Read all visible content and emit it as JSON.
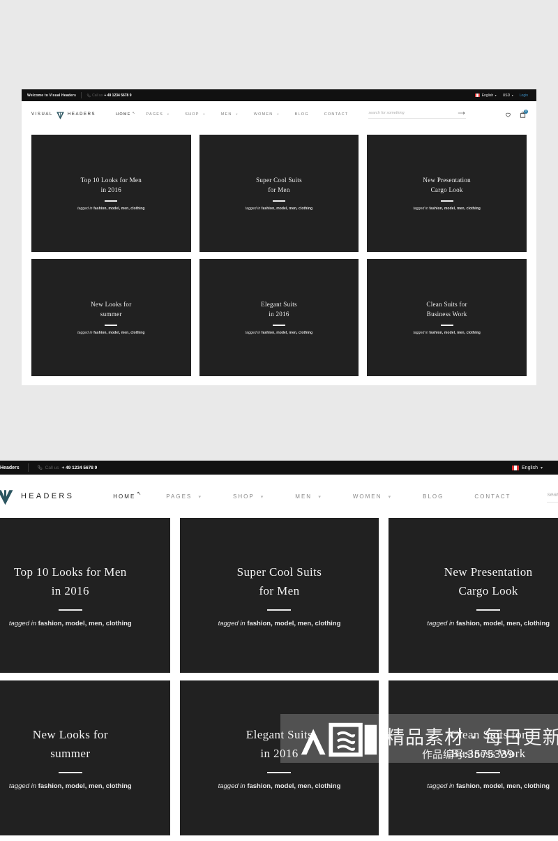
{
  "site": {
    "background_color": "#e9e9e9",
    "accent_color": "#2f7fa8",
    "card_color": "#212121",
    "topbar_color": "#111111"
  },
  "topbar": {
    "welcome": "Welcome to Visual Headers",
    "call_us_label": "Call us",
    "phone": "+ 49 1234 5678 9",
    "language": "English",
    "currency": "USD",
    "login": "Login",
    "caret": "▾",
    "phone_icon": "phone-icon",
    "flag_icon": "flag-icon"
  },
  "brand": {
    "word_left": "VISUAL",
    "word_right": "HEADERS",
    "mark": "v-shield-logo"
  },
  "nav": {
    "items": [
      {
        "label": "HOME",
        "caret": "",
        "superscript": "↖",
        "active": true
      },
      {
        "label": "PAGES",
        "caret": "▾",
        "superscript": "",
        "active": false
      },
      {
        "label": "SHOP",
        "caret": "▾",
        "superscript": "",
        "active": false
      },
      {
        "label": "MEN",
        "caret": "▾",
        "superscript": "",
        "active": false
      },
      {
        "label": "WOMEN",
        "caret": "▾",
        "superscript": "",
        "active": false
      },
      {
        "label": "BLOG",
        "caret": "",
        "superscript": "",
        "active": false
      },
      {
        "label": "CONTACT",
        "caret": "",
        "superscript": "",
        "active": false
      }
    ]
  },
  "search": {
    "placeholder": "search for something",
    "value": "",
    "submit_icon": "arrow-right-icon"
  },
  "icons": {
    "wishlist": "heart-icon",
    "cart": "shopping-bag-icon",
    "cart_count": "0"
  },
  "cards": [
    {
      "title_line1": "Top 10 Looks for Men",
      "title_line2": "in 2016",
      "tag_prefix": "tagged in",
      "tag_list": "fashion, model, men, clothing"
    },
    {
      "title_line1": "Super Cool Suits",
      "title_line2": "for Men",
      "tag_prefix": "tagged in",
      "tag_list": "fashion, model, men, clothing"
    },
    {
      "title_line1": "New Presentation",
      "title_line2": "Cargo Look",
      "tag_prefix": "tagged in",
      "tag_list": "fashion, model, men, clothing"
    },
    {
      "title_line1": "New Looks for",
      "title_line2": "summer",
      "tag_prefix": "tagged in",
      "tag_list": "fashion, model, men, clothing"
    },
    {
      "title_line1": "Elegant Suits",
      "title_line2": "in 2016",
      "tag_prefix": "tagged in",
      "tag_list": "fashion, model, men, clothing"
    },
    {
      "title_line1": "Clean Suits for",
      "title_line2": "Business Work",
      "tag_prefix": "tagged in",
      "tag_list": "fashion, model, men, clothing"
    }
  ],
  "zoomed_topbar": {
    "welcome": "Headers",
    "call_us_label": "Call us",
    "phone": "+ 49 1234 5678 9",
    "language": "English",
    "caret": "▾"
  },
  "zoomed_brand": {
    "word_right": "HEADERS"
  },
  "watermark": {
    "logo_text": "众图网",
    "tagline": "精品素材 · 每日更新",
    "code": "作品编号:3575339"
  }
}
